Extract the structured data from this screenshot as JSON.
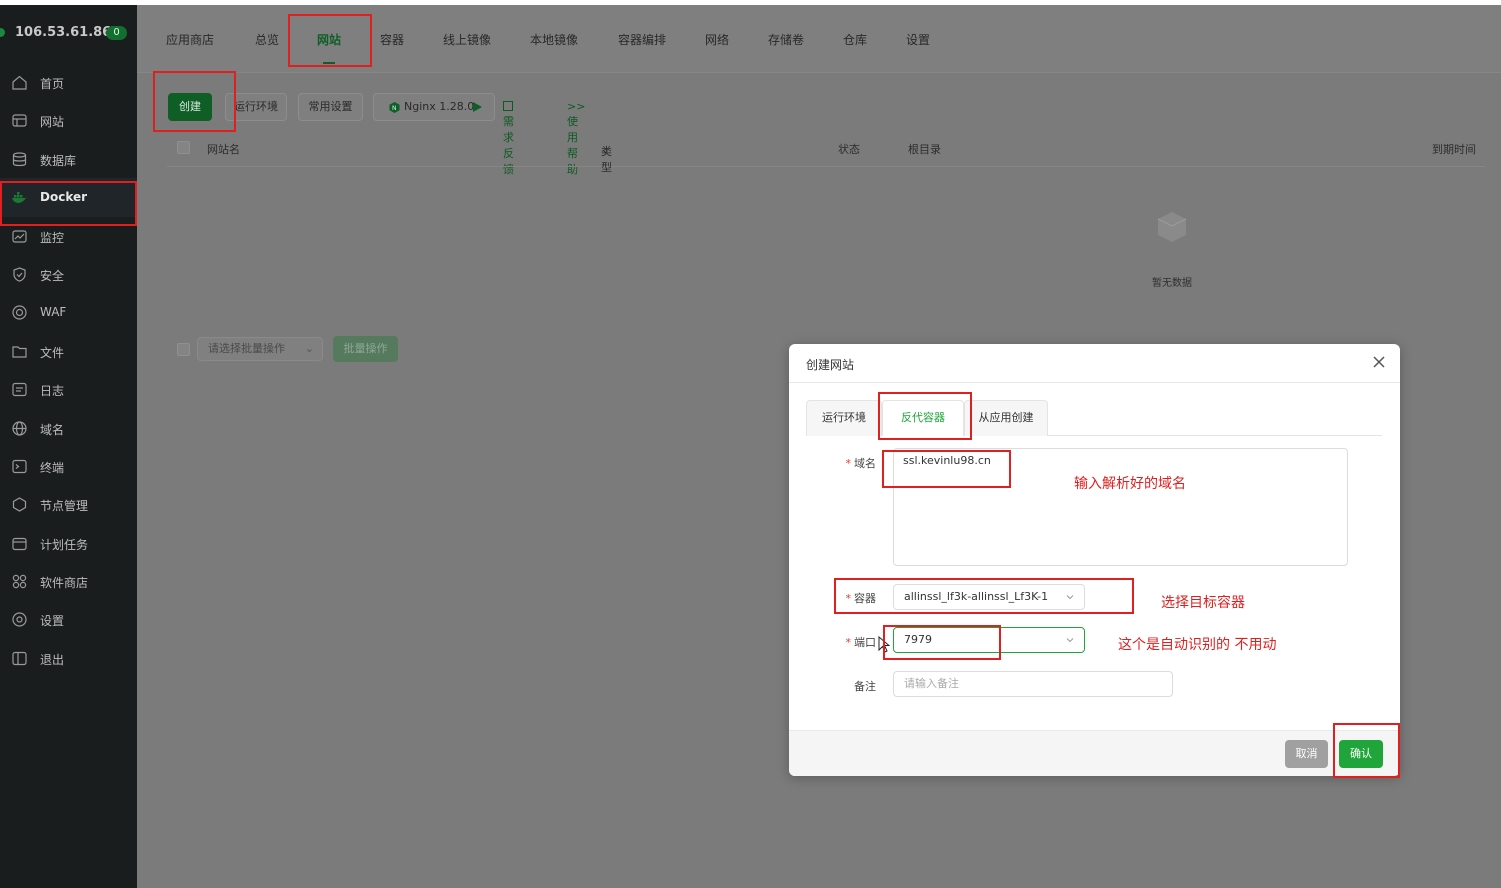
{
  "server": {
    "ip": "106.53.61.86",
    "badge": "0"
  },
  "sidebar": {
    "items": [
      {
        "label": "首页",
        "icon": "home-icon"
      },
      {
        "label": "网站",
        "icon": "website-icon"
      },
      {
        "label": "数据库",
        "icon": "database-icon"
      },
      {
        "label": "Docker",
        "icon": "docker-icon",
        "active": true
      },
      {
        "label": "监控",
        "icon": "monitor-icon"
      },
      {
        "label": "安全",
        "icon": "shield-icon"
      },
      {
        "label": "WAF",
        "icon": "waf-icon"
      },
      {
        "label": "文件",
        "icon": "folder-icon"
      },
      {
        "label": "日志",
        "icon": "log-icon"
      },
      {
        "label": "域名",
        "icon": "globe-icon"
      },
      {
        "label": "终端",
        "icon": "terminal-icon"
      },
      {
        "label": "节点管理",
        "icon": "node-icon"
      },
      {
        "label": "计划任务",
        "icon": "calendar-icon"
      },
      {
        "label": "软件商店",
        "icon": "store-icon"
      },
      {
        "label": "设置",
        "icon": "gear-icon"
      },
      {
        "label": "退出",
        "icon": "logout-icon"
      }
    ]
  },
  "tabs": {
    "items": [
      "应用商店",
      "总览",
      "网站",
      "容器",
      "线上镜像",
      "本地镜像",
      "容器编排",
      "网络",
      "存储卷",
      "仓库",
      "设置"
    ],
    "active": "网站"
  },
  "toolbar": {
    "create": "创建",
    "runtime": "运行环境",
    "common": "常用设置",
    "nginx": "Nginx 1.28.0",
    "feedback": "需求反馈",
    "help": ">>使用帮助"
  },
  "table": {
    "columns": {
      "name": "网站名",
      "type": "类型",
      "status": "状态",
      "root": "根目录",
      "expire": "到期时间"
    },
    "empty": "暂无数据"
  },
  "batch": {
    "placeholder": "请选择批量操作",
    "button": "批量操作"
  },
  "dialog": {
    "title": "创建网站",
    "tabs": [
      "运行环境",
      "反代容器",
      "从应用创建"
    ],
    "active_tab": "反代容器",
    "domain": {
      "label": "域名",
      "value": "ssl.kevinlu98.cn"
    },
    "container": {
      "label": "容器",
      "value": "allinssl_lf3k-allinssl_Lf3K-1"
    },
    "port": {
      "label": "端口",
      "value": "7979"
    },
    "remark": {
      "label": "备注",
      "placeholder": "请输入备注"
    },
    "cancel": "取消",
    "confirm": "确认"
  },
  "annotations": {
    "domain_note": "输入解析好的域名",
    "container_note": "选择目标容器",
    "port_note": "这个是自动识别的  不用动"
  },
  "colors": {
    "accent": "#20a53a",
    "annotation": "#e02020",
    "sidebar": "#1a1d1e"
  }
}
